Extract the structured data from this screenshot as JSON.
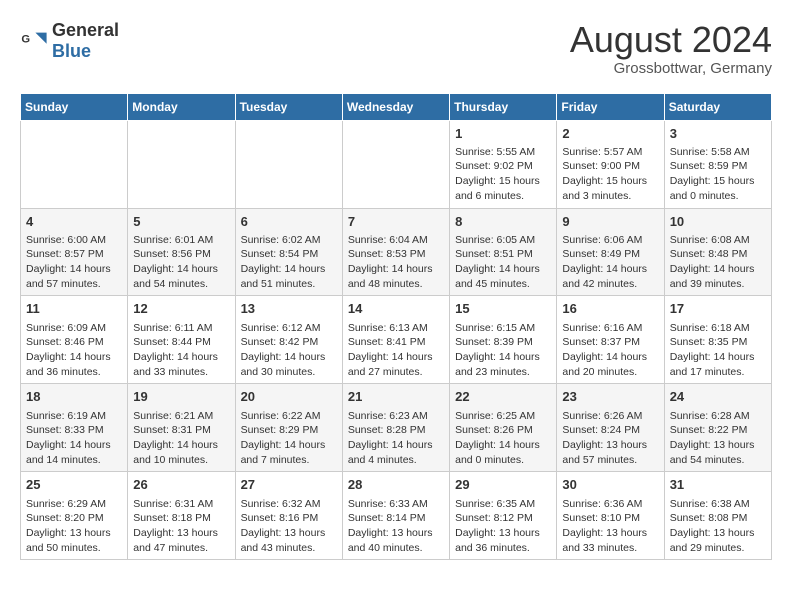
{
  "header": {
    "logo_general": "General",
    "logo_blue": "Blue",
    "month_year": "August 2024",
    "location": "Grossbottwar, Germany"
  },
  "weekdays": [
    "Sunday",
    "Monday",
    "Tuesday",
    "Wednesday",
    "Thursday",
    "Friday",
    "Saturday"
  ],
  "weeks": [
    [
      {
        "day": "",
        "info": ""
      },
      {
        "day": "",
        "info": ""
      },
      {
        "day": "",
        "info": ""
      },
      {
        "day": "",
        "info": ""
      },
      {
        "day": "1",
        "info": "Sunrise: 5:55 AM\nSunset: 9:02 PM\nDaylight: 15 hours and 6 minutes."
      },
      {
        "day": "2",
        "info": "Sunrise: 5:57 AM\nSunset: 9:00 PM\nDaylight: 15 hours and 3 minutes."
      },
      {
        "day": "3",
        "info": "Sunrise: 5:58 AM\nSunset: 8:59 PM\nDaylight: 15 hours and 0 minutes."
      }
    ],
    [
      {
        "day": "4",
        "info": "Sunrise: 6:00 AM\nSunset: 8:57 PM\nDaylight: 14 hours and 57 minutes."
      },
      {
        "day": "5",
        "info": "Sunrise: 6:01 AM\nSunset: 8:56 PM\nDaylight: 14 hours and 54 minutes."
      },
      {
        "day": "6",
        "info": "Sunrise: 6:02 AM\nSunset: 8:54 PM\nDaylight: 14 hours and 51 minutes."
      },
      {
        "day": "7",
        "info": "Sunrise: 6:04 AM\nSunset: 8:53 PM\nDaylight: 14 hours and 48 minutes."
      },
      {
        "day": "8",
        "info": "Sunrise: 6:05 AM\nSunset: 8:51 PM\nDaylight: 14 hours and 45 minutes."
      },
      {
        "day": "9",
        "info": "Sunrise: 6:06 AM\nSunset: 8:49 PM\nDaylight: 14 hours and 42 minutes."
      },
      {
        "day": "10",
        "info": "Sunrise: 6:08 AM\nSunset: 8:48 PM\nDaylight: 14 hours and 39 minutes."
      }
    ],
    [
      {
        "day": "11",
        "info": "Sunrise: 6:09 AM\nSunset: 8:46 PM\nDaylight: 14 hours and 36 minutes."
      },
      {
        "day": "12",
        "info": "Sunrise: 6:11 AM\nSunset: 8:44 PM\nDaylight: 14 hours and 33 minutes."
      },
      {
        "day": "13",
        "info": "Sunrise: 6:12 AM\nSunset: 8:42 PM\nDaylight: 14 hours and 30 minutes."
      },
      {
        "day": "14",
        "info": "Sunrise: 6:13 AM\nSunset: 8:41 PM\nDaylight: 14 hours and 27 minutes."
      },
      {
        "day": "15",
        "info": "Sunrise: 6:15 AM\nSunset: 8:39 PM\nDaylight: 14 hours and 23 minutes."
      },
      {
        "day": "16",
        "info": "Sunrise: 6:16 AM\nSunset: 8:37 PM\nDaylight: 14 hours and 20 minutes."
      },
      {
        "day": "17",
        "info": "Sunrise: 6:18 AM\nSunset: 8:35 PM\nDaylight: 14 hours and 17 minutes."
      }
    ],
    [
      {
        "day": "18",
        "info": "Sunrise: 6:19 AM\nSunset: 8:33 PM\nDaylight: 14 hours and 14 minutes."
      },
      {
        "day": "19",
        "info": "Sunrise: 6:21 AM\nSunset: 8:31 PM\nDaylight: 14 hours and 10 minutes."
      },
      {
        "day": "20",
        "info": "Sunrise: 6:22 AM\nSunset: 8:29 PM\nDaylight: 14 hours and 7 minutes."
      },
      {
        "day": "21",
        "info": "Sunrise: 6:23 AM\nSunset: 8:28 PM\nDaylight: 14 hours and 4 minutes."
      },
      {
        "day": "22",
        "info": "Sunrise: 6:25 AM\nSunset: 8:26 PM\nDaylight: 14 hours and 0 minutes."
      },
      {
        "day": "23",
        "info": "Sunrise: 6:26 AM\nSunset: 8:24 PM\nDaylight: 13 hours and 57 minutes."
      },
      {
        "day": "24",
        "info": "Sunrise: 6:28 AM\nSunset: 8:22 PM\nDaylight: 13 hours and 54 minutes."
      }
    ],
    [
      {
        "day": "25",
        "info": "Sunrise: 6:29 AM\nSunset: 8:20 PM\nDaylight: 13 hours and 50 minutes."
      },
      {
        "day": "26",
        "info": "Sunrise: 6:31 AM\nSunset: 8:18 PM\nDaylight: 13 hours and 47 minutes."
      },
      {
        "day": "27",
        "info": "Sunrise: 6:32 AM\nSunset: 8:16 PM\nDaylight: 13 hours and 43 minutes."
      },
      {
        "day": "28",
        "info": "Sunrise: 6:33 AM\nSunset: 8:14 PM\nDaylight: 13 hours and 40 minutes."
      },
      {
        "day": "29",
        "info": "Sunrise: 6:35 AM\nSunset: 8:12 PM\nDaylight: 13 hours and 36 minutes."
      },
      {
        "day": "30",
        "info": "Sunrise: 6:36 AM\nSunset: 8:10 PM\nDaylight: 13 hours and 33 minutes."
      },
      {
        "day": "31",
        "info": "Sunrise: 6:38 AM\nSunset: 8:08 PM\nDaylight: 13 hours and 29 minutes."
      }
    ]
  ]
}
